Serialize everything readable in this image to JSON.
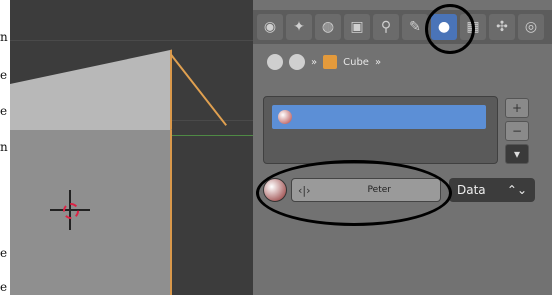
{
  "page_edge_text": [
    "n",
    "e",
    "e",
    "n",
    "e",
    "e"
  ],
  "tabs": [
    {
      "icon": "render-icon"
    },
    {
      "icon": "scene-icon"
    },
    {
      "icon": "world-icon"
    },
    {
      "icon": "object-icon"
    },
    {
      "icon": "constraints-icon"
    },
    {
      "icon": "modifiers-icon"
    },
    {
      "icon": "material-icon",
      "active": true
    },
    {
      "icon": "texture-icon"
    },
    {
      "icon": "particles-icon"
    },
    {
      "icon": "physics-icon"
    }
  ],
  "context": {
    "object_name": "Cube",
    "separator": "»"
  },
  "material_slot_buttons": [
    "+",
    "−",
    "▾"
  ],
  "material": {
    "browse_icon": "‹|›",
    "name": "Peter",
    "link_select": "Data",
    "link_chevron": "⌃⌄"
  },
  "colors": {
    "active_tab": "#4a74b8",
    "selected_slot": "#5c8fd6"
  }
}
